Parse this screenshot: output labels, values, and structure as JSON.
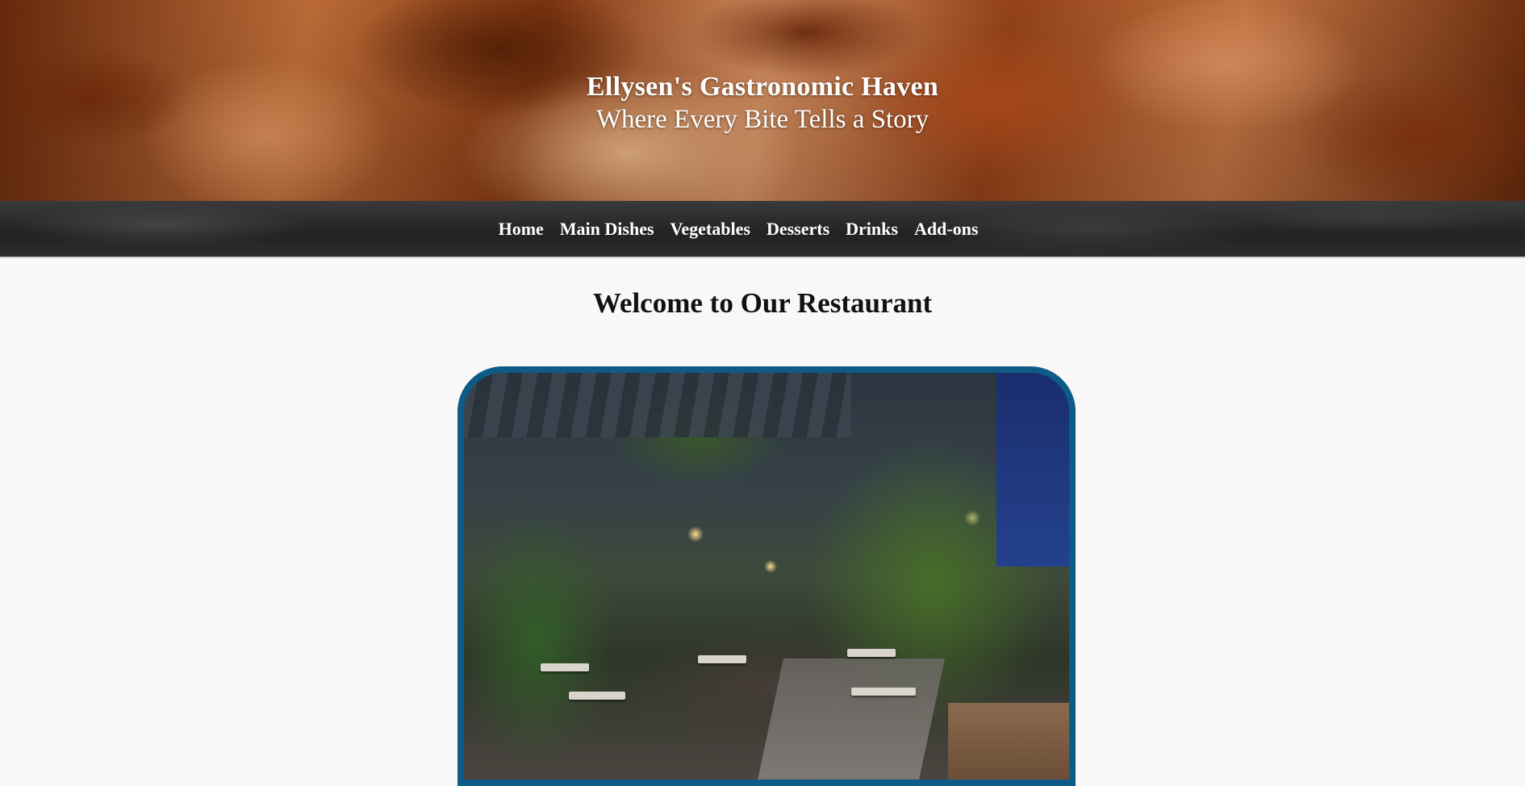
{
  "header": {
    "title": "Ellysen's Gastronomic Haven",
    "tagline": "Where Every Bite Tells a Story"
  },
  "nav": {
    "items": [
      {
        "id": "home",
        "label": "Home"
      },
      {
        "id": "main-dishes",
        "label": "Main Dishes"
      },
      {
        "id": "vegetables",
        "label": "Vegetables"
      },
      {
        "id": "desserts",
        "label": "Desserts"
      },
      {
        "id": "drinks",
        "label": "Drinks"
      },
      {
        "id": "add-ons",
        "label": "Add-ons"
      }
    ]
  },
  "main": {
    "heading": "Welcome to Our Restaurant"
  },
  "colors": {
    "photo_border": "#0d5b86",
    "nav_background": "#2a2a2a",
    "page_background": "#f8f8f8"
  }
}
